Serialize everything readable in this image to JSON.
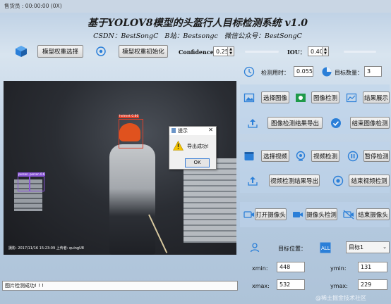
{
  "window": {
    "title": "售货员 : 00:00:00 (0X)"
  },
  "header": {
    "title": "基于YOLOV8模型的头盔行人目标检测系统 v1.0",
    "subtitle": "CSDN：BestSongC   B站：Bestsongc   微信公众号：BestSongC"
  },
  "toolbar": {
    "select_weights": "模型权重选择",
    "init_weights": "模型权重初始化",
    "confidence_label": "Confidence",
    "confidence_value": "0.25",
    "iou_label": "IOU：",
    "iou_value": "0.40"
  },
  "stats": {
    "time_label": "检测用时：",
    "time_value": "0.055",
    "count_label": "目标数量：",
    "count_value": "3"
  },
  "image_panel": {
    "select": "选择图像",
    "detect": "图像检测",
    "show": "结果展示",
    "export": "图像检测结果导出",
    "finish": "结束图像检测"
  },
  "video_panel": {
    "select": "选择视频",
    "detect": "视频检测",
    "pause": "暂停检测",
    "export": "视频检测结果导出",
    "finish": "结束视频检测"
  },
  "camera_panel": {
    "open": "打开摄像头",
    "detect": "摄像头检测",
    "finish": "结束摄像头"
  },
  "target": {
    "label": "目标位置：",
    "selected": "目标1",
    "xmin_label": "xmin:",
    "xmin": "448",
    "ymin_label": "ymin:",
    "ymin": "131",
    "xmax_label": "xmax:",
    "xmax": "532",
    "ymax_label": "ymax:",
    "ymax": "229"
  },
  "canvas": {
    "detections": [
      {
        "label": "helmet 0.86"
      },
      {
        "label": "person 0.5"
      },
      {
        "label": "person 0.6"
      }
    ],
    "watermark": "摄影: 2017/11/16 15:23:09 上传者: quingU8"
  },
  "dialog": {
    "title": "提示",
    "message": "导出成功!",
    "ok": "OK"
  },
  "status": {
    "text": "图片检测成功! ! !"
  },
  "footer": {
    "credit": "@稀土掘金技术社区"
  },
  "colors": {
    "accent": "#2b7fd8",
    "helmet_box": "#e0402a",
    "person_box": "#8a55d8"
  }
}
